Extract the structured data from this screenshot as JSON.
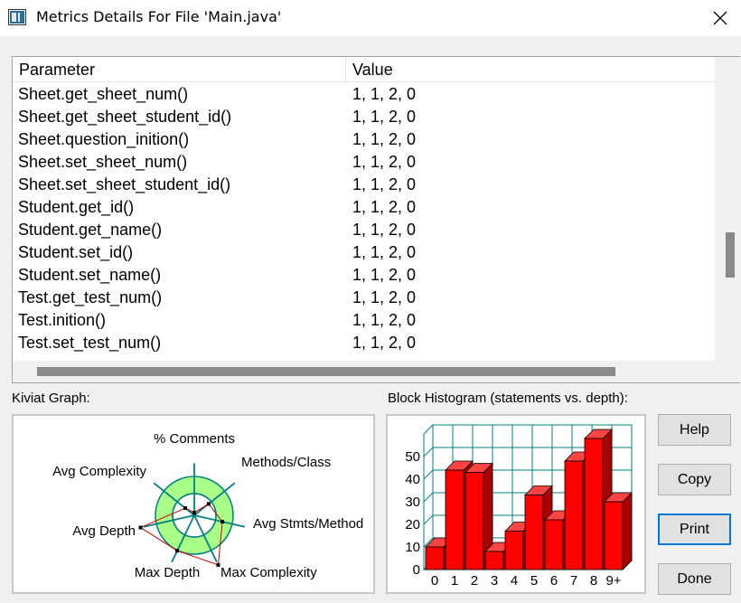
{
  "window": {
    "title": "Metrics Details For File 'Main.java'"
  },
  "list": {
    "columns": [
      "Parameter",
      "Value"
    ],
    "rows": [
      [
        "Sheet.get_sheet_num()",
        "1, 1, 2, 0"
      ],
      [
        "Sheet.get_sheet_student_id()",
        "1, 1, 2, 0"
      ],
      [
        "Sheet.question_inition()",
        "1, 1, 2, 0"
      ],
      [
        "Sheet.set_sheet_num()",
        "1, 1, 2, 0"
      ],
      [
        "Sheet.set_sheet_student_id()",
        "1, 1, 2, 0"
      ],
      [
        "Student.get_id()",
        "1, 1, 2, 0"
      ],
      [
        "Student.get_name()",
        "1, 1, 2, 0"
      ],
      [
        "Student.set_id()",
        "1, 1, 2, 0"
      ],
      [
        "Student.set_name()",
        "1, 1, 2, 0"
      ],
      [
        "Test.get_test_num()",
        "1, 1, 2, 0"
      ],
      [
        "Test.inition()",
        "1, 1, 2, 0"
      ],
      [
        "Test.set_test_num()",
        "1, 1, 2, 0"
      ]
    ]
  },
  "kiviat": {
    "label": "Kiviat Graph:",
    "axes": [
      "% Comments",
      "Methods/Class",
      "Avg Stmts/Method",
      "Max Complexity",
      "Max Depth",
      "Avg Depth",
      "Avg Complexity"
    ],
    "values": [
      0.05,
      0.35,
      0.55,
      1.05,
      0.75,
      1.05,
      0.22
    ],
    "ring_inner_color": "#ffffff",
    "ring_fill_color": "#aaff88",
    "axis_color": "#008080",
    "polygon_color": "#cc0000"
  },
  "histogram": {
    "label": "Block Histogram (statements vs. depth):",
    "chart_data": {
      "type": "bar",
      "categories": [
        "0",
        "1",
        "2",
        "3",
        "4",
        "5",
        "6",
        "7",
        "8",
        "9+"
      ],
      "values": [
        10,
        44,
        43,
        8,
        17,
        33,
        22,
        48,
        58,
        30
      ],
      "yticks": [
        "0",
        "10",
        "20",
        "30",
        "40",
        "50"
      ],
      "ylim": [
        0,
        60
      ],
      "bar_color": "#ff0000",
      "grid_color": "#008080"
    }
  },
  "buttons": {
    "help": "Help",
    "copy": "Copy",
    "print": "Print",
    "done": "Done"
  }
}
